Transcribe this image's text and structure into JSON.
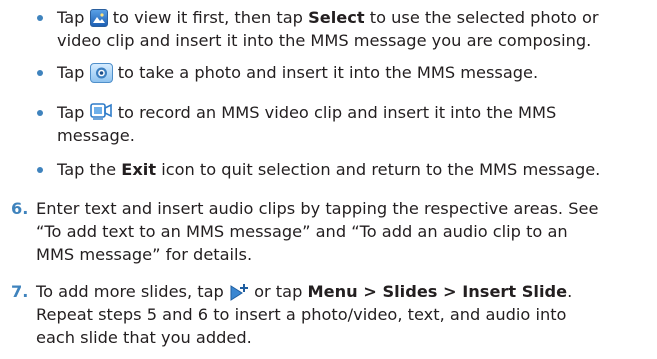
{
  "bullets": [
    {
      "line1": [
        {
          "t": "Tap "
        },
        {
          "icon": "photo-album-icon"
        },
        {
          "t": " to view it first, then tap "
        },
        {
          "b": "Select"
        },
        {
          "t": " to use the selected photo or"
        }
      ],
      "line2": "video clip and insert it into the MMS message you are composing."
    },
    {
      "line1": [
        {
          "t": "Tap "
        },
        {
          "icon": "camera-icon"
        },
        {
          "t": " to take a photo and insert it into the MMS message."
        }
      ]
    },
    {
      "line1": [
        {
          "t": "Tap "
        },
        {
          "icon": "video-camera-icon"
        },
        {
          "t": " to record an MMS video clip and insert it into the MMS"
        }
      ],
      "line2": "message."
    },
    {
      "line1": [
        {
          "t": "Tap the "
        },
        {
          "b": "Exit"
        },
        {
          "t": " icon to quit selection and return to the MMS message."
        }
      ]
    }
  ],
  "steps": [
    {
      "num": "6.",
      "lines": [
        "Enter text and insert audio clips by tapping the respective areas. See",
        "“To add text to an MMS message” and “To add an audio clip to an",
        "MMS message” for details."
      ]
    },
    {
      "num": "7.",
      "line1": [
        {
          "t": "To add more slides, tap "
        },
        {
          "icon": "insert-slide-icon"
        },
        {
          "t": " or tap "
        },
        {
          "b": "Menu > Slides > Insert Slide"
        },
        {
          "t": "."
        }
      ],
      "lines": [
        "Repeat steps 5 and 6 to insert a photo/video, text, and audio into",
        "each slide that you added."
      ]
    }
  ],
  "colors": {
    "accent": "#3f83bd",
    "text": "#231f20"
  }
}
